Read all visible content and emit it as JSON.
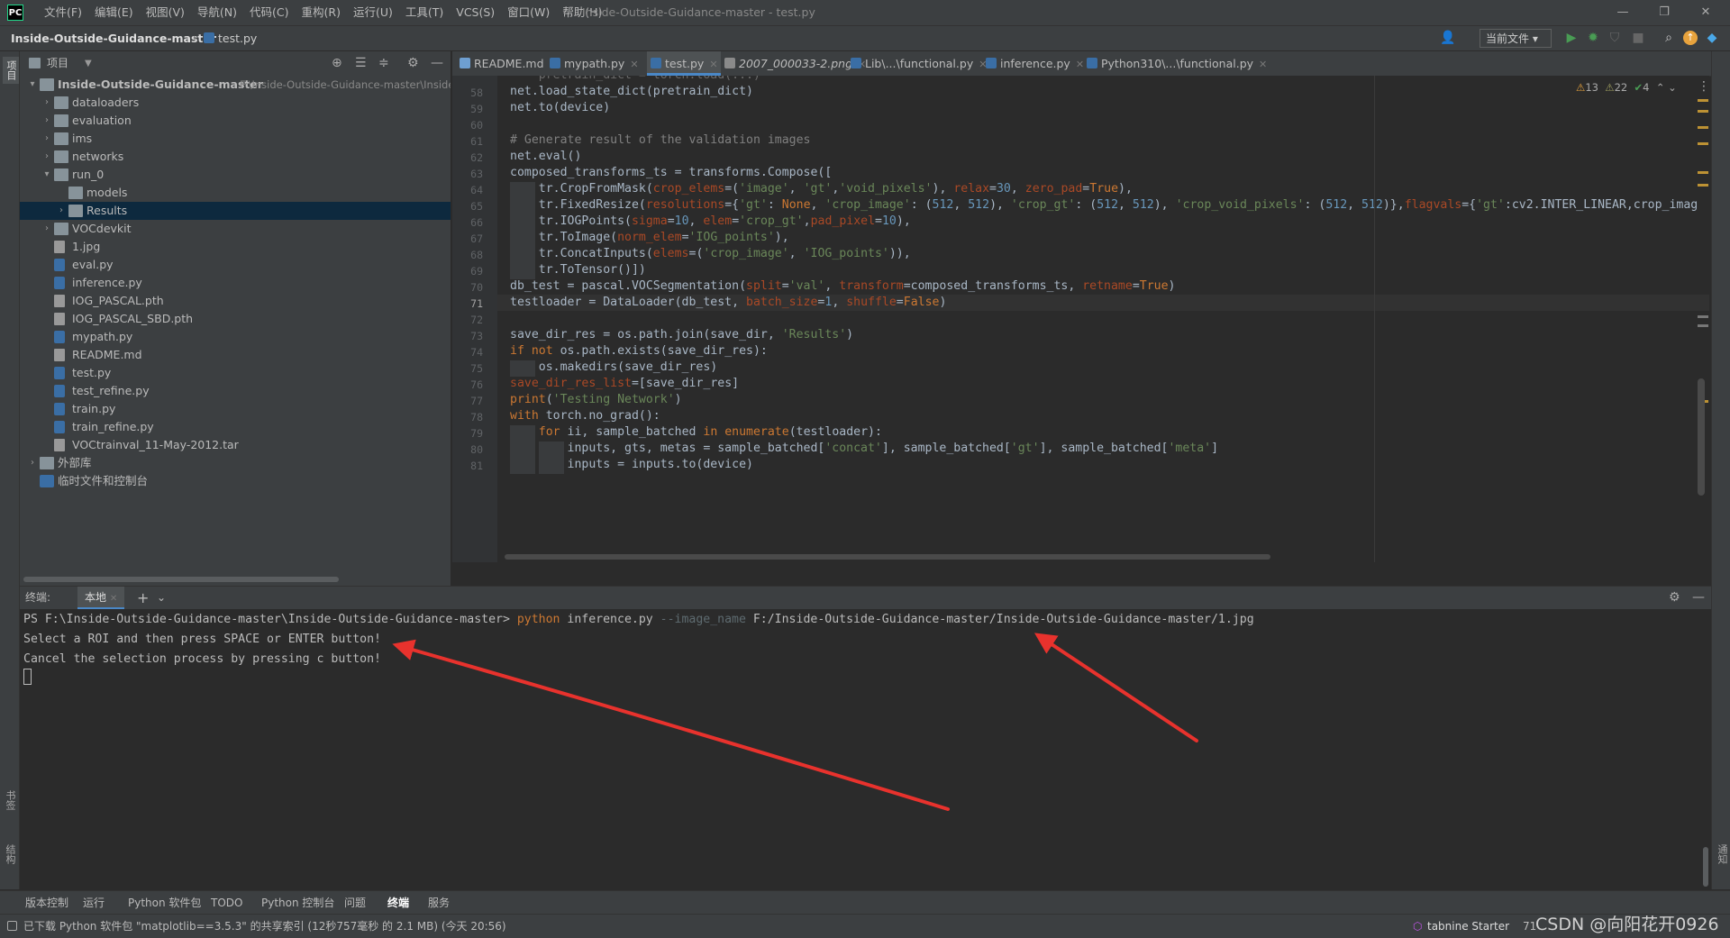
{
  "app": {
    "logo_text": "PC",
    "menu": [
      "文件(F)",
      "编辑(E)",
      "视图(V)",
      "导航(N)",
      "代码(C)",
      "重构(R)",
      "运行(U)",
      "工具(T)",
      "VCS(S)",
      "窗口(W)",
      "帮助(H)"
    ],
    "window_title": "Inside-Outside-Guidance-master - test.py"
  },
  "nav": {
    "project": "Inside-Outside-Guidance-master",
    "file": "test.py",
    "run_config": "当前文件"
  },
  "left_strip": {
    "project_label": "项目",
    "bookmarks_label": "书签",
    "structure_label": "结构"
  },
  "right_strip": {
    "notifications_label": "通知"
  },
  "project_panel": {
    "title": "项目",
    "tree": [
      {
        "label": "Inside-Outside-Guidance-master",
        "path": "F:\\Inside-Outside-Guidance-master\\Inside",
        "kind": "folder",
        "depth": 0,
        "expanded": true,
        "bold": true
      },
      {
        "label": "dataloaders",
        "kind": "folder",
        "depth": 1,
        "expanded": false
      },
      {
        "label": "evaluation",
        "kind": "folder",
        "depth": 1,
        "expanded": false
      },
      {
        "label": "ims",
        "kind": "folder",
        "depth": 1,
        "expanded": false
      },
      {
        "label": "networks",
        "kind": "folder",
        "depth": 1,
        "expanded": false
      },
      {
        "label": "run_0",
        "kind": "folder",
        "depth": 1,
        "expanded": true
      },
      {
        "label": "models",
        "kind": "folder",
        "depth": 2,
        "leaf": true
      },
      {
        "label": "Results",
        "kind": "folder",
        "depth": 2,
        "expanded": false,
        "selected": true
      },
      {
        "label": "VOCdevkit",
        "kind": "folder",
        "depth": 1,
        "expanded": false
      },
      {
        "label": "1.jpg",
        "kind": "file",
        "depth": 1,
        "leaf": true
      },
      {
        "label": "eval.py",
        "kind": "py",
        "depth": 1,
        "leaf": true
      },
      {
        "label": "inference.py",
        "kind": "py",
        "depth": 1,
        "leaf": true
      },
      {
        "label": "IOG_PASCAL.pth",
        "kind": "file",
        "depth": 1,
        "leaf": true
      },
      {
        "label": "IOG_PASCAL_SBD.pth",
        "kind": "file",
        "depth": 1,
        "leaf": true
      },
      {
        "label": "mypath.py",
        "kind": "py",
        "depth": 1,
        "leaf": true
      },
      {
        "label": "README.md",
        "kind": "file",
        "depth": 1,
        "leaf": true
      },
      {
        "label": "test.py",
        "kind": "py",
        "depth": 1,
        "leaf": true
      },
      {
        "label": "test_refine.py",
        "kind": "py",
        "depth": 1,
        "leaf": true
      },
      {
        "label": "train.py",
        "kind": "py",
        "depth": 1,
        "leaf": true
      },
      {
        "label": "train_refine.py",
        "kind": "py",
        "depth": 1,
        "leaf": true
      },
      {
        "label": "VOCtrainval_11-May-2012.tar",
        "kind": "file",
        "depth": 1,
        "leaf": true
      },
      {
        "label": "外部库",
        "kind": "lib",
        "depth": 0,
        "expanded": false
      },
      {
        "label": "临时文件和控制台",
        "kind": "scratch",
        "depth": 0,
        "leaf": true
      }
    ]
  },
  "editor": {
    "tabs": [
      {
        "label": "README.md",
        "color": "#6e9fd1"
      },
      {
        "label": "mypath.py",
        "color": "#3a6ea5"
      },
      {
        "label": "test.py",
        "color": "#3a6ea5",
        "active": true
      },
      {
        "label": "2007_000033-2.png",
        "color": "#8a8a8a",
        "italic": true
      },
      {
        "label": "Lib\\...\\functional.py",
        "color": "#3a6ea5"
      },
      {
        "label": "inference.py",
        "color": "#3a6ea5"
      },
      {
        "label": "Python310\\...\\functional.py",
        "color": "#3a6ea5"
      }
    ],
    "inspection": {
      "warn_count": "13",
      "weak_warn_count": "22",
      "ok_count": "4"
    },
    "current_line": "71",
    "lines": [
      {
        "n": "",
        "html": "    pretrain_dict = torch.load(...)"
      },
      {
        "n": "58",
        "code": "net.load_state_dict(pretrain_dict)"
      },
      {
        "n": "59",
        "code": "net.to(device)"
      },
      {
        "n": "60",
        "code": ""
      },
      {
        "n": "61",
        "code": "# Generate result of the validation images"
      },
      {
        "n": "62",
        "code": "net.eval()"
      },
      {
        "n": "63",
        "code": "composed_transforms_ts = transforms.Compose(["
      },
      {
        "n": "64",
        "code": "    tr.CropFromMask(crop_elems=('image', 'gt','void_pixels'), relax=30, zero_pad=True),"
      },
      {
        "n": "65",
        "code": "    tr.FixedResize(resolutions={'gt': None, 'crop_image': (512, 512), 'crop_gt': (512, 512), 'crop_void_pixels': (512, 512)},flagvals={'gt':cv2.INTER_LINEAR,'crop_imag"
      },
      {
        "n": "66",
        "code": "    tr.IOGPoints(sigma=10, elem='crop_gt',pad_pixel=10),"
      },
      {
        "n": "67",
        "code": "    tr.ToImage(norm_elem='IOG_points'),"
      },
      {
        "n": "68",
        "code": "    tr.ConcatInputs(elems=('crop_image', 'IOG_points')),"
      },
      {
        "n": "69",
        "code": "    tr.ToTensor()])"
      },
      {
        "n": "70",
        "code": "db_test = pascal.VOCSegmentation(split='val', transform=composed_transforms_ts, retname=True)"
      },
      {
        "n": "71",
        "code": "testloader = DataLoader(db_test, batch_size=1, shuffle=False)"
      },
      {
        "n": "72",
        "code": ""
      },
      {
        "n": "73",
        "code": "save_dir_res = os.path.join(save_dir, 'Results')"
      },
      {
        "n": "74",
        "code": "if not os.path.exists(save_dir_res):"
      },
      {
        "n": "75",
        "code": "    os.makedirs(save_dir_res)"
      },
      {
        "n": "76",
        "code": "save_dir_res_list=[save_dir_res]"
      },
      {
        "n": "77",
        "code": "print('Testing Network')"
      },
      {
        "n": "78",
        "code": "with torch.no_grad():"
      },
      {
        "n": "79",
        "code": "    for ii, sample_batched in enumerate(testloader):"
      },
      {
        "n": "80",
        "code": "        inputs, gts, metas = sample_batched['concat'], sample_batched['gt'], sample_batched['meta']"
      },
      {
        "n": "81",
        "code": "        inputs = inputs.to(device)"
      }
    ]
  },
  "terminal": {
    "label": "终端:",
    "tab": "本地",
    "lines": [
      {
        "prompt": "PS F:\\Inside-Outside-Guidance-master\\Inside-Outside-Guidance-master> ",
        "cmd": "python",
        "rest": " inference.py ",
        "opt": "--image_name",
        "arg": " F:/Inside-Outside-Guidance-master/Inside-Outside-Guidance-master/1.jpg"
      },
      {
        "text": "Select a ROI and then press SPACE or ENTER button!"
      },
      {
        "text": "Cancel the selection process by pressing c button!"
      }
    ]
  },
  "tool_windows": [
    "版本控制",
    "运行",
    "Python 软件包",
    "TODO",
    "Python 控制台",
    "问题",
    "终端",
    "服务"
  ],
  "active_tool_window": "终端",
  "status": {
    "message": "已下载 Python 软件包 \"matplotlib==3.5.3\" 的共享索引 (12秒757毫秒 的 2.1 MB) (今天 20:56)",
    "tabnine": "tabnine Starter",
    "col": "71",
    "watermark": "CSDN @向阳花开0926"
  },
  "colors": {
    "accent": "#4a88c7",
    "selection": "#0d293e",
    "annotation_arrow": "#e8322d"
  }
}
